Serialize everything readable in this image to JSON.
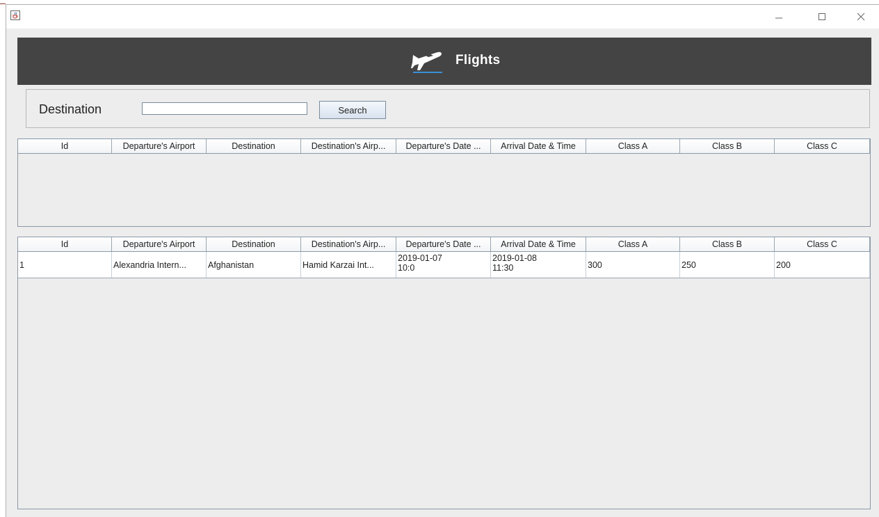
{
  "header": {
    "title": "Flights"
  },
  "search": {
    "label": "Destination",
    "value": "",
    "button_label": "Search"
  },
  "columns": [
    "Id",
    "Departure's Airport",
    "Destination",
    "Destination's Airp...",
    "Departure's Date ...",
    "Arrival Date & Time",
    "Class A",
    "Class B",
    "Class C"
  ],
  "results_rows": [
    {
      "id": "1",
      "departure_airport": "Alexandria Intern...",
      "destination": "Afghanistan",
      "destination_airport": "Hamid Karzai Int...",
      "departure_date": "2019-01-07",
      "departure_time": "10:0",
      "arrival_date": "2019-01-08",
      "arrival_time": "11:30",
      "class_a": "300",
      "class_b": "250",
      "class_c": "200"
    }
  ],
  "icons": {
    "app": "java-cup-icon",
    "logo": "airplane-icon",
    "minimize": "minimize-icon",
    "maximize": "maximize-icon",
    "close": "close-icon"
  },
  "colors": {
    "header_bg": "#444444",
    "window_bg": "#ededed",
    "header_text": "#ffffff"
  }
}
